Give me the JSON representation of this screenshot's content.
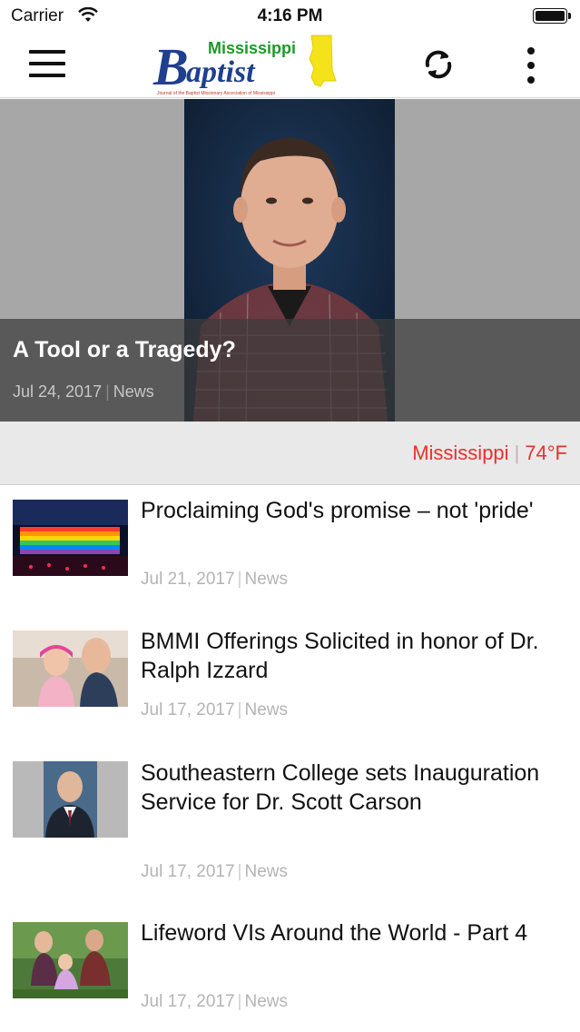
{
  "status_bar": {
    "carrier": "Carrier",
    "time": "4:16 PM"
  },
  "header": {
    "logo": {
      "top_word": "Mississippi",
      "main_word": "Baptist",
      "tagline": "Journal of the Baptist Missionary Association of Mississippi"
    },
    "icons": {
      "menu": "hamburger-menu-icon",
      "refresh": "refresh-icon",
      "more": "more-vertical-icon"
    }
  },
  "hero": {
    "title": "A Tool or a Tragedy?",
    "date": "Jul 24, 2017",
    "separator": "|",
    "category": "News"
  },
  "weather": {
    "location": "Mississippi",
    "separator": "|",
    "temperature": "74°F",
    "accent_color": "#e8312c"
  },
  "articles": [
    {
      "title": "Proclaiming God's promise – not 'pride'",
      "date": "Jul 21, 2017",
      "separator": "|",
      "category": "News",
      "thumb": "rainbow-lit-building-photo"
    },
    {
      "title": "BMMI Offerings Solicited in honor of Dr. Ralph Izzard",
      "date": "Jul 17, 2017",
      "separator": "|",
      "category": "News",
      "thumb": "man-with-child-photo"
    },
    {
      "title": "Southeastern College sets Inauguration Service for Dr. Scott Carson",
      "date": "Jul 17, 2017",
      "separator": "|",
      "category": "News",
      "thumb": "man-in-suit-portrait"
    },
    {
      "title": "Lifeword VIs Around the World - Part 4",
      "date": "Jul 17, 2017",
      "separator": "|",
      "category": "News",
      "thumb": "family-outdoors-photo"
    }
  ]
}
